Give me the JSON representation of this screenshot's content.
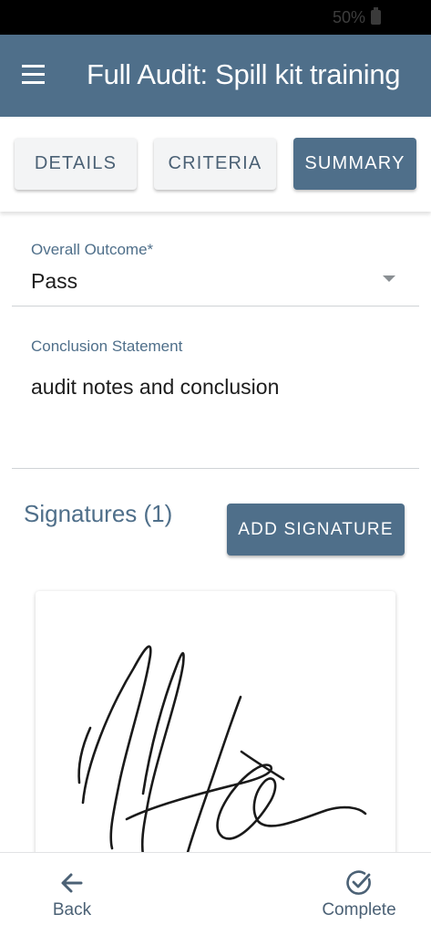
{
  "status_bar": {
    "battery": "50%"
  },
  "app_bar": {
    "title": "Full Audit: Spill kit training"
  },
  "tabs": [
    {
      "label": "DETAILS",
      "active": false
    },
    {
      "label": "CRITERIA",
      "active": false
    },
    {
      "label": "SUMMARY",
      "active": true
    }
  ],
  "form": {
    "overall_outcome": {
      "label": "Overall Outcome*",
      "value": "Pass"
    },
    "conclusion": {
      "label": "Conclusion Statement",
      "value": "audit notes and conclusion"
    }
  },
  "signatures": {
    "heading": "Signatures (1)",
    "add_label": "ADD SIGNATURE"
  },
  "bottom_nav": {
    "back_label": "Back",
    "complete_label": "Complete"
  },
  "colors": {
    "primary": "#4f6f8a",
    "tab_inactive_bg": "#f3f4f5",
    "text_dark": "#1d1d1d"
  }
}
